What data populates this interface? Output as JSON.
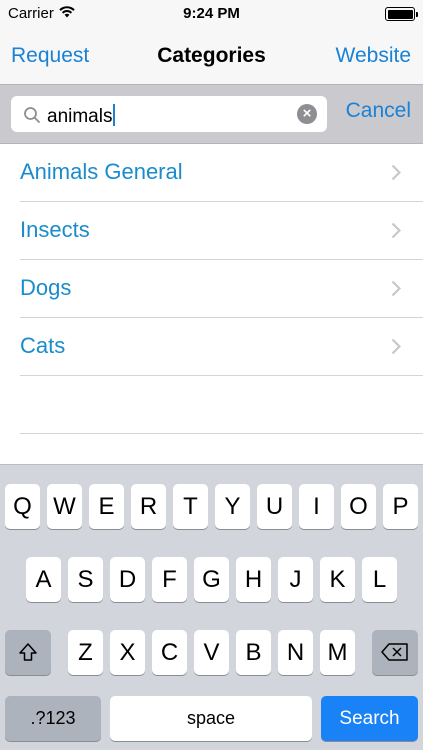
{
  "status_bar": {
    "carrier": "Carrier",
    "time": "9:24 PM",
    "wifi_icon": "wifi-icon",
    "battery_level": 1.0
  },
  "nav": {
    "left_label": "Request",
    "title": "Categories",
    "right_label": "Website"
  },
  "search": {
    "value": "animals",
    "cancel_label": "Cancel"
  },
  "results": [
    {
      "label": "Animals General"
    },
    {
      "label": "Insects"
    },
    {
      "label": "Dogs"
    },
    {
      "label": "Cats"
    }
  ],
  "keyboard": {
    "row1": [
      "Q",
      "W",
      "E",
      "R",
      "T",
      "Y",
      "U",
      "I",
      "O",
      "P"
    ],
    "row2": [
      "A",
      "S",
      "D",
      "F",
      "G",
      "H",
      "J",
      "K",
      "L"
    ],
    "row3": [
      "Z",
      "X",
      "C",
      "V",
      "B",
      "N",
      "M"
    ],
    "numbers_label": ".?123",
    "space_label": "space",
    "search_label": "Search",
    "accent_color": "#1a82f7"
  },
  "colors": {
    "tint": "#1a82d6",
    "list_text": "#1a8ccc"
  }
}
